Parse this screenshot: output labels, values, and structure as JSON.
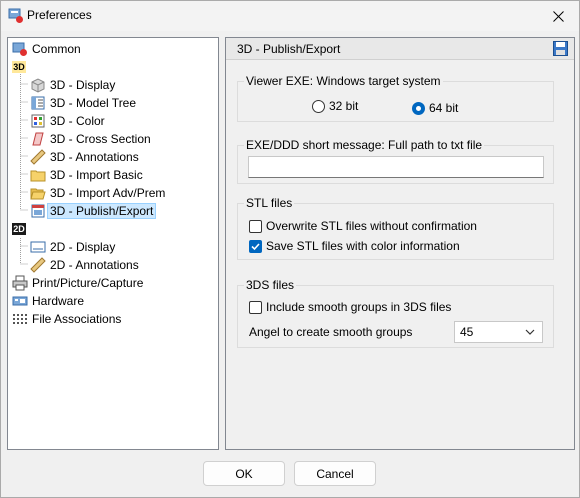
{
  "window": {
    "title": "Preferences",
    "close_glyph": "✕"
  },
  "tree": {
    "common": "Common",
    "group3d_tag": "3D",
    "items3d": [
      "3D - Display",
      "3D - Model Tree",
      "3D - Color",
      "3D - Cross Section",
      "3D - Annotations",
      "3D - Import Basic",
      "3D - Import Adv/Prem",
      "3D - Publish/Export"
    ],
    "group2d_tag": "2D",
    "items2d": [
      "2D - Display",
      "2D - Annotations"
    ],
    "print": "Print/Picture/Capture",
    "hardware": "Hardware",
    "file_assoc": "File Associations"
  },
  "panel": {
    "header": "3D - Publish/Export",
    "viewer": {
      "legend": "Viewer EXE: Windows target system",
      "opt32": "32 bit",
      "opt64": "64 bit",
      "selected": "64 bit"
    },
    "message": {
      "legend": "EXE/DDD short message: Full path to txt file",
      "value": ""
    },
    "stl": {
      "legend": "STL files",
      "overwrite": "Overwrite STL files without confirmation",
      "overwrite_checked": false,
      "color": "Save STL files with color information",
      "color_checked": true
    },
    "tds": {
      "legend": "3DS files",
      "smooth": "Include smooth groups in 3DS files",
      "smooth_checked": false,
      "angle_label": "Angel to create smooth groups",
      "angle_value": "45"
    }
  },
  "buttons": {
    "ok": "OK",
    "cancel": "Cancel"
  },
  "colors": {
    "accent": "#0067c0",
    "selection": "#cce8ff"
  }
}
